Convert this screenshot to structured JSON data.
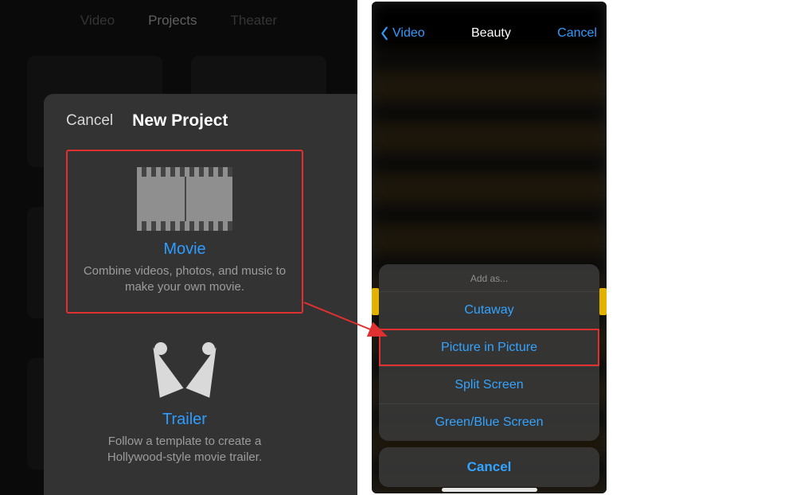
{
  "left": {
    "tabs": {
      "video": "Video",
      "projects": "Projects",
      "theater": "Theater"
    },
    "sheet": {
      "cancel": "Cancel",
      "title": "New Project",
      "movie": {
        "label": "Movie",
        "desc": "Combine videos, photos, and music to make your own movie."
      },
      "trailer": {
        "label": "Trailer",
        "desc": "Follow a template to create a Hollywood-style movie trailer."
      }
    }
  },
  "right": {
    "header": {
      "back": "Video",
      "title": "Beauty",
      "cancel": "Cancel"
    },
    "sheet": {
      "header": "Add as...",
      "items": {
        "cutaway": "Cutaway",
        "pip": "Picture in Picture",
        "split": "Split Screen",
        "green": "Green/Blue Screen"
      },
      "cancel": "Cancel"
    }
  }
}
